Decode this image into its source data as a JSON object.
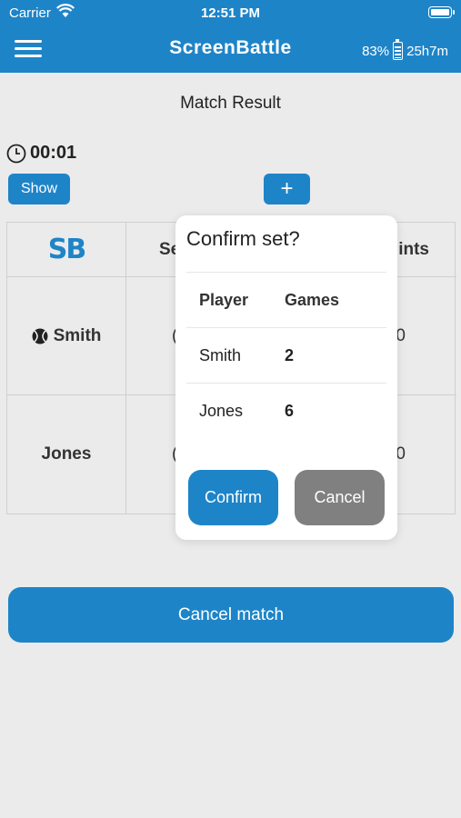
{
  "status_bar": {
    "carrier": "Carrier",
    "time": "12:51 PM"
  },
  "nav": {
    "title": "ScreenBattle",
    "battery_percent": "83%",
    "remaining": "25h7m"
  },
  "page": {
    "title": "Match Result"
  },
  "timer": {
    "value": "00:01"
  },
  "controls": {
    "show_label": "Show",
    "add_label": "+"
  },
  "table": {
    "logo": "SB",
    "columns": [
      "Se",
      "",
      "ints"
    ],
    "rows": [
      {
        "player": "Smith",
        "sets": "(",
        "points": "0"
      },
      {
        "player": "Jones",
        "sets": "(",
        "points": "0"
      }
    ]
  },
  "dialog": {
    "title": "Confirm set?",
    "headers": {
      "player": "Player",
      "games": "Games"
    },
    "rows": [
      {
        "player": "Smith",
        "games": "2"
      },
      {
        "player": "Jones",
        "games": "6"
      }
    ],
    "confirm_label": "Confirm",
    "cancel_label": "Cancel"
  },
  "footer": {
    "cancel_match_label": "Cancel match"
  },
  "colors": {
    "accent": "#1e84c8",
    "cancel_gray": "#808080",
    "background": "#ebebeb"
  }
}
